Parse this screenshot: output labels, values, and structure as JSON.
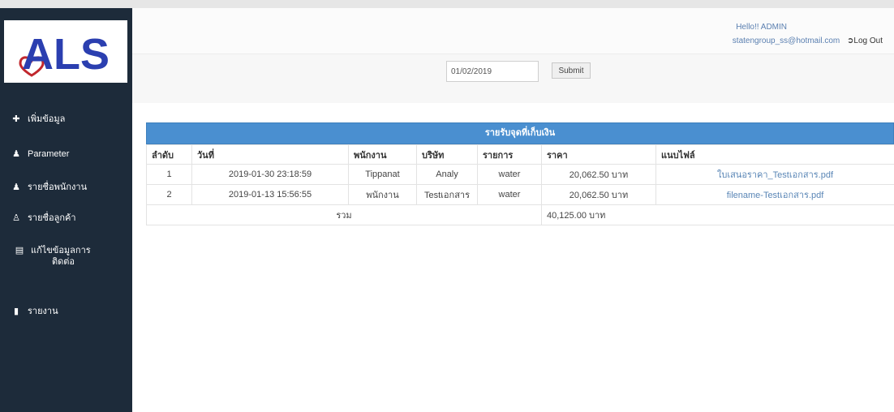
{
  "brand": {
    "logo_text": "ALS"
  },
  "colors": {
    "sidebar_bg": "#1d2b3a",
    "panel_header": "#4a8fd0",
    "logo_text": "#2b3fb0",
    "logo_heart": "#c1272d",
    "link": "#5a86b6"
  },
  "sidebar": {
    "items": [
      {
        "label": "เพิ่มข้อมูล",
        "icon": "plus-circle-icon"
      },
      {
        "label": "Parameter",
        "icon": "user-icon"
      },
      {
        "label": "รายชื่อพนักงาน",
        "icon": "user-icon"
      },
      {
        "label": "รายชื่อลูกค้า",
        "icon": "users-icon"
      },
      {
        "label_line1": "แก้ไขข้อมูลการ",
        "label_line2": "ติดต่อ",
        "icon": "id-card-icon"
      },
      {
        "label": "รายงาน",
        "icon": "book-icon"
      }
    ]
  },
  "header": {
    "greeting": "Hello!! ADMIN",
    "email": "statengroup_ss@hotmail.com",
    "logout_label": "Log Out",
    "logout_icon": "sign-out-icon"
  },
  "filter": {
    "date_value": "01/02/2019",
    "submit_label": "Submit"
  },
  "report": {
    "title": "รายรับจุดที่เก็บเงิน",
    "columns": [
      "ลำดับ",
      "วันที่",
      "พนักงาน",
      "บริษัท",
      "รายการ",
      "ราคา",
      "แนบไฟล์"
    ],
    "rows": [
      {
        "no": "1",
        "date": "2019-01-30 23:18:59",
        "employee": "Tippanat",
        "company": "Analy",
        "item": "water",
        "price": "20,062.50 บาท",
        "file": "ใบเสนอราคา_Testเอกสาร.pdf"
      },
      {
        "no": "2",
        "date": "2019-01-13 15:56:55",
        "employee": "พนักงาน",
        "company": "Testเอกสาร",
        "item": "water",
        "price": "20,062.50 บาท",
        "file": "filename-Testเอกสาร.pdf"
      }
    ],
    "total_label": "รวม",
    "total_value": "40,125.00 บาท"
  }
}
